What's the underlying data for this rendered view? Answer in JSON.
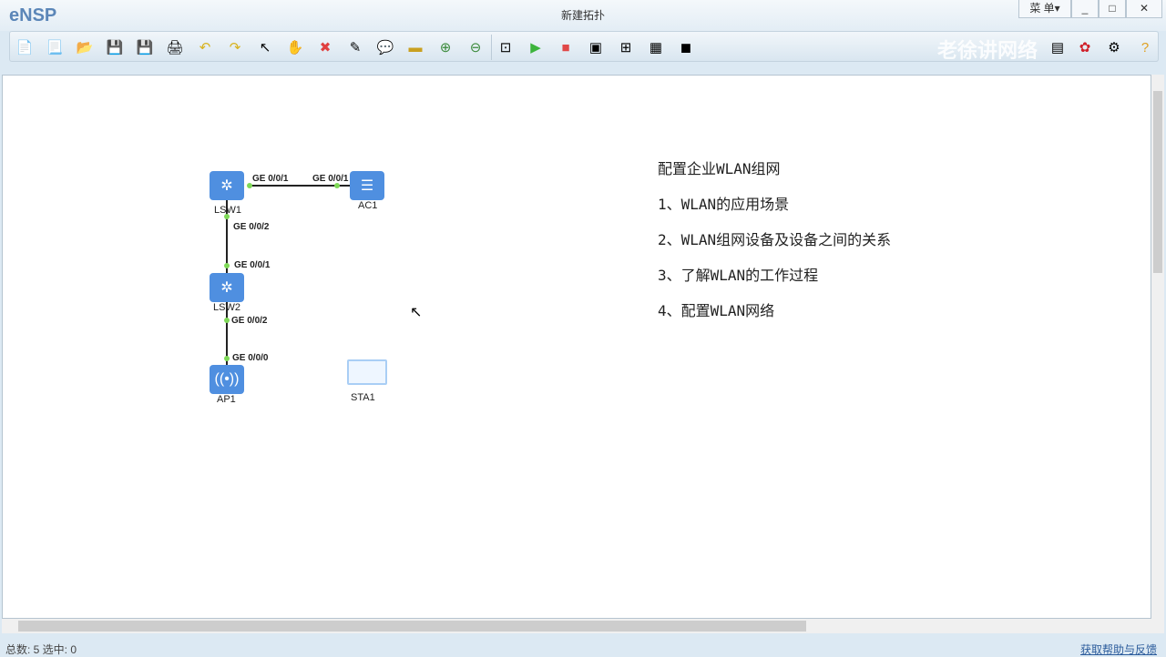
{
  "app": {
    "logo": "eNSP",
    "title": "新建拓扑",
    "menu": "菜 单▾",
    "minimize": "_",
    "maximize": "□",
    "close": "✕",
    "watermark": "老徐讲网络"
  },
  "toolbar": [
    "new-topology",
    "new-lab",
    "open",
    "save",
    "save-as",
    "print",
    "undo",
    "redo",
    "select",
    "pan",
    "delete",
    "delete-links",
    "text",
    "palette",
    "zoom-in",
    "zoom-out",
    "fit",
    "start",
    "stop",
    "capture",
    "topology",
    "grid",
    "console"
  ],
  "toolbar_right": [
    "forum",
    "huawei",
    "settings",
    "help"
  ],
  "topology": {
    "devices": [
      {
        "name": "LSW1"
      },
      {
        "name": "AC1"
      },
      {
        "name": "LSW2"
      },
      {
        "name": "AP1"
      },
      {
        "name": "STA1"
      }
    ],
    "ports": [
      "GE 0/0/1",
      "GE 0/0/1",
      "GE 0/0/2",
      "GE 0/0/1",
      "GE 0/0/2",
      "GE 0/0/0"
    ]
  },
  "notes": {
    "title": "配置企业WLAN组网",
    "items": [
      "1、WLAN的应用场景",
      "2、WLAN组网设备及设备之间的关系",
      "3、了解WLAN的工作过程",
      "4、配置WLAN网络"
    ]
  },
  "status": {
    "left": "总数: 5 选中: 0",
    "help_link": "获取帮助与反馈"
  },
  "colors": {
    "device": "#4f8fe0",
    "port": "#7ed957"
  }
}
